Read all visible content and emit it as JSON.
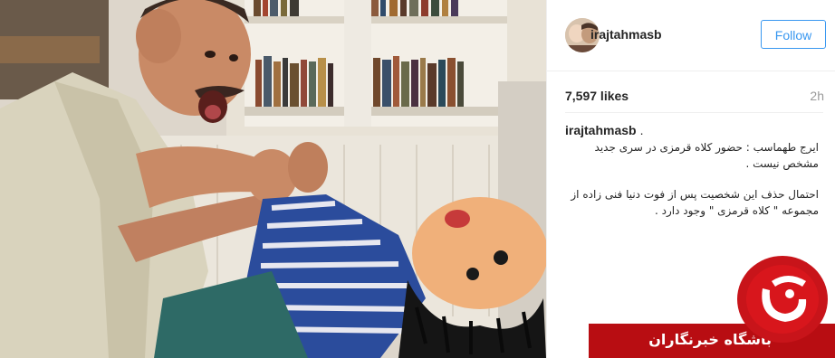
{
  "post": {
    "username": "irajtahmasb",
    "follow_label": "Follow",
    "likes": "7,597 likes",
    "time": "2h",
    "caption_user": "irajtahmasb",
    "caption_dot": ".",
    "caption_lines": [
      "ایرج طهماسب : حضور کلاه قرمزی در سری جدید",
      "مشخص نیست .",
      "احتمال حذف این شخصیت پس از فوت دنیا فنی زاده از",
      "مجموعه \" کلاه قرمزی \" وجود دارد ."
    ]
  },
  "watermark": {
    "text": "باشگاه خبرنگاران"
  },
  "colors": {
    "follow_blue": "#3897f0",
    "watermark_red": "#b80d12"
  }
}
